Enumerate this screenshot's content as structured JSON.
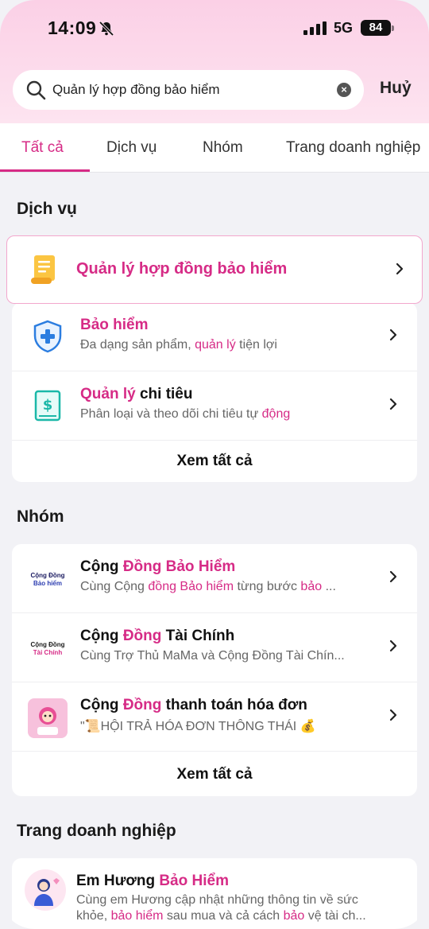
{
  "status": {
    "time": "14:09",
    "network": "5G",
    "battery": "84"
  },
  "search": {
    "query": "Quản lý hợp đồng bảo hiểm",
    "cancel": "Huỷ"
  },
  "tabs": [
    "Tất cả",
    "Dịch vụ",
    "Nhóm",
    "Trang doanh nghiệp"
  ],
  "services": {
    "title": "Dịch vụ",
    "top_result": "Quản lý hợp đồng bảo hiểm",
    "items": [
      {
        "title_hl": "Bảo hiểm",
        "title_rest": "",
        "sub_a": "Đa dạng sản phẩm, ",
        "sub_hl": "quản lý",
        "sub_b": " tiện lợi",
        "icon": "shield-plus-icon"
      },
      {
        "title_hl": "Quản lý",
        "title_rest": " chi tiêu",
        "sub_a": "Phân loại và theo dõi chi tiêu tự ",
        "sub_hl": "động",
        "sub_b": "",
        "icon": "money-book-icon"
      }
    ],
    "see_all": "Xem tất cả"
  },
  "groups": {
    "title": "Nhóm",
    "items": [
      {
        "t_a": "Cộng ",
        "t_hl": "Đồng Bảo Hiểm",
        "t_b": "",
        "s_a": "Cùng Cộng ",
        "s_hl": "đồng Bảo hiểm",
        "s_b": " từng bước ",
        "s_hl2": "bảo",
        "s_c": " ...",
        "logo_a": "Cộng Đồng",
        "logo_b": "Bảo hiểm"
      },
      {
        "t_a": "Cộng ",
        "t_hl": "Đồng",
        "t_b": " Tài Chính",
        "s_a": "Cùng Trợ Thủ MaMa và Cộng Đồng Tài Chín...",
        "s_hl": "",
        "s_b": "",
        "s_hl2": "",
        "s_c": "",
        "logo_a": "Cộng Đồng",
        "logo_b": "Tài Chính"
      },
      {
        "t_a": "Cộng ",
        "t_hl": "Đồng",
        "t_b": " thanh toán hóa đơn",
        "s_a": "\"📜HỘI TRẢ HÓA ĐƠN THÔNG THÁI 💰",
        "s_hl": "",
        "s_b": "",
        "s_hl2": "",
        "s_c": "",
        "logo_a": "",
        "logo_b": ""
      }
    ],
    "see_all": "Xem tất cả"
  },
  "business": {
    "title": "Trang doanh nghiệp",
    "item": {
      "t_a": "Em Hương ",
      "t_hl": "Bảo Hiểm",
      "line1": "Cùng em Hương cập nhật những thông tin về sức",
      "l2_a": "khỏe, ",
      "l2_hl": "bảo hiểm",
      "l2_b": " sau mua và cả cách ",
      "l2_hl2": "bảo",
      "l2_c": " vệ tài ch..."
    }
  },
  "colors": {
    "accent": "#d62b86",
    "header_gradient": "#fbd0e6"
  }
}
